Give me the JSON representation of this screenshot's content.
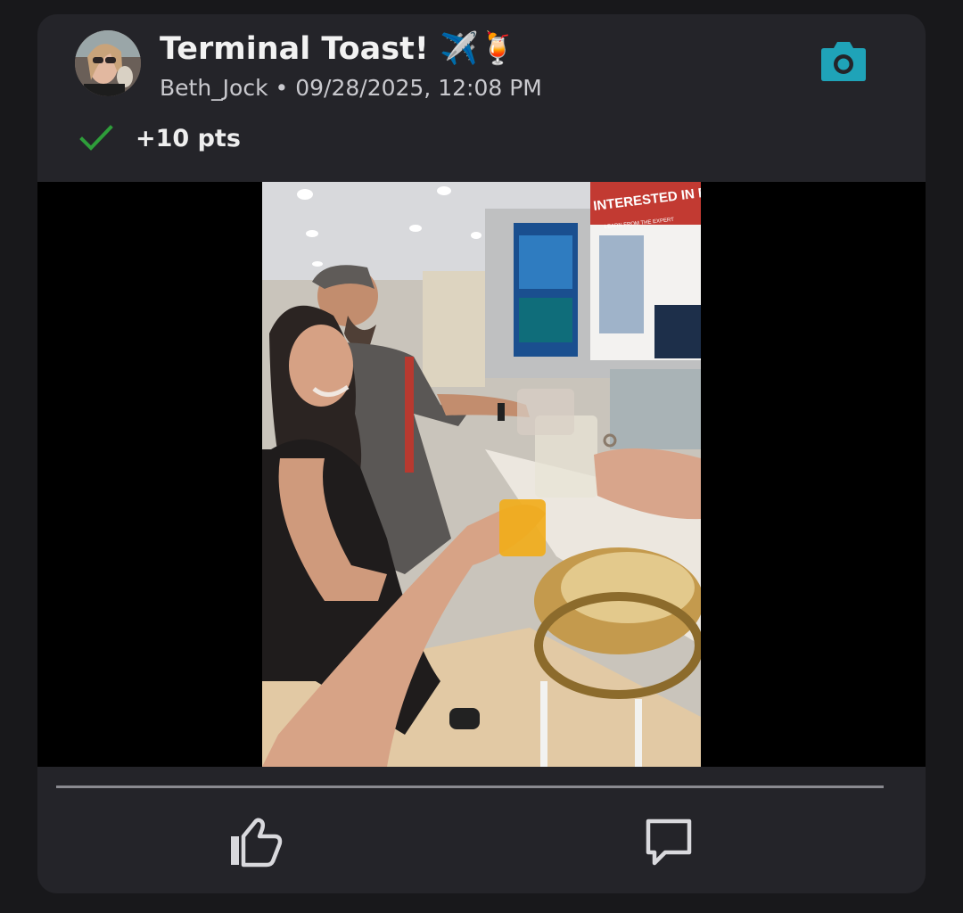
{
  "post": {
    "title": "Terminal Toast! ✈️🍹",
    "author": "Beth_Jock",
    "separator": " • ",
    "timestamp": "09/28/2025, 12:08 PM",
    "points": "+10 pts",
    "media_sign_text": "INTERESTED IN BELIZ",
    "media_sign_subtext": "LEARN FROM THE EXPERT"
  },
  "icons": {
    "camera": "camera-icon",
    "check": "check-icon",
    "like": "thumbs-up-icon",
    "comment": "comment-icon"
  },
  "colors": {
    "background": "#18181b",
    "card": "#242429",
    "accent": "#1fa3b8",
    "check": "#2e9d3a",
    "text_primary": "#f2f2f2",
    "text_secondary": "#c9c9ce"
  }
}
